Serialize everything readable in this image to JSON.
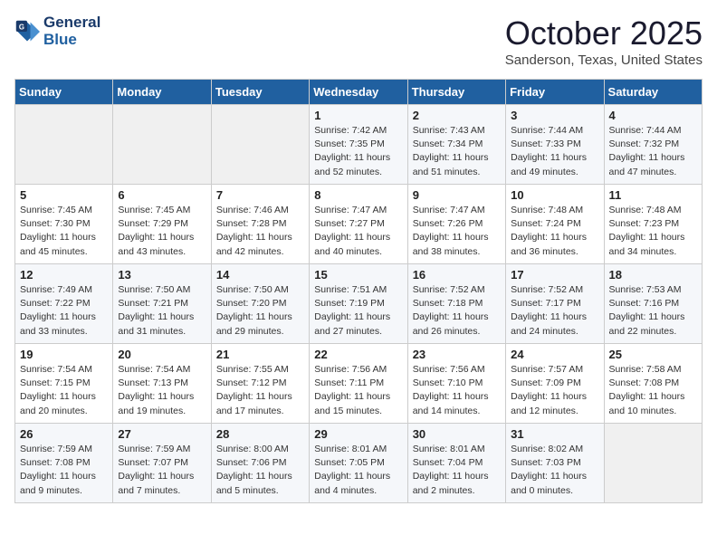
{
  "header": {
    "logo_general": "General",
    "logo_blue": "Blue",
    "month": "October 2025",
    "location": "Sanderson, Texas, United States"
  },
  "days_of_week": [
    "Sunday",
    "Monday",
    "Tuesday",
    "Wednesday",
    "Thursday",
    "Friday",
    "Saturday"
  ],
  "weeks": [
    [
      {
        "day": "",
        "content": ""
      },
      {
        "day": "",
        "content": ""
      },
      {
        "day": "",
        "content": ""
      },
      {
        "day": "1",
        "content": "Sunrise: 7:42 AM\nSunset: 7:35 PM\nDaylight: 11 hours\nand 52 minutes."
      },
      {
        "day": "2",
        "content": "Sunrise: 7:43 AM\nSunset: 7:34 PM\nDaylight: 11 hours\nand 51 minutes."
      },
      {
        "day": "3",
        "content": "Sunrise: 7:44 AM\nSunset: 7:33 PM\nDaylight: 11 hours\nand 49 minutes."
      },
      {
        "day": "4",
        "content": "Sunrise: 7:44 AM\nSunset: 7:32 PM\nDaylight: 11 hours\nand 47 minutes."
      }
    ],
    [
      {
        "day": "5",
        "content": "Sunrise: 7:45 AM\nSunset: 7:30 PM\nDaylight: 11 hours\nand 45 minutes."
      },
      {
        "day": "6",
        "content": "Sunrise: 7:45 AM\nSunset: 7:29 PM\nDaylight: 11 hours\nand 43 minutes."
      },
      {
        "day": "7",
        "content": "Sunrise: 7:46 AM\nSunset: 7:28 PM\nDaylight: 11 hours\nand 42 minutes."
      },
      {
        "day": "8",
        "content": "Sunrise: 7:47 AM\nSunset: 7:27 PM\nDaylight: 11 hours\nand 40 minutes."
      },
      {
        "day": "9",
        "content": "Sunrise: 7:47 AM\nSunset: 7:26 PM\nDaylight: 11 hours\nand 38 minutes."
      },
      {
        "day": "10",
        "content": "Sunrise: 7:48 AM\nSunset: 7:24 PM\nDaylight: 11 hours\nand 36 minutes."
      },
      {
        "day": "11",
        "content": "Sunrise: 7:48 AM\nSunset: 7:23 PM\nDaylight: 11 hours\nand 34 minutes."
      }
    ],
    [
      {
        "day": "12",
        "content": "Sunrise: 7:49 AM\nSunset: 7:22 PM\nDaylight: 11 hours\nand 33 minutes."
      },
      {
        "day": "13",
        "content": "Sunrise: 7:50 AM\nSunset: 7:21 PM\nDaylight: 11 hours\nand 31 minutes."
      },
      {
        "day": "14",
        "content": "Sunrise: 7:50 AM\nSunset: 7:20 PM\nDaylight: 11 hours\nand 29 minutes."
      },
      {
        "day": "15",
        "content": "Sunrise: 7:51 AM\nSunset: 7:19 PM\nDaylight: 11 hours\nand 27 minutes."
      },
      {
        "day": "16",
        "content": "Sunrise: 7:52 AM\nSunset: 7:18 PM\nDaylight: 11 hours\nand 26 minutes."
      },
      {
        "day": "17",
        "content": "Sunrise: 7:52 AM\nSunset: 7:17 PM\nDaylight: 11 hours\nand 24 minutes."
      },
      {
        "day": "18",
        "content": "Sunrise: 7:53 AM\nSunset: 7:16 PM\nDaylight: 11 hours\nand 22 minutes."
      }
    ],
    [
      {
        "day": "19",
        "content": "Sunrise: 7:54 AM\nSunset: 7:15 PM\nDaylight: 11 hours\nand 20 minutes."
      },
      {
        "day": "20",
        "content": "Sunrise: 7:54 AM\nSunset: 7:13 PM\nDaylight: 11 hours\nand 19 minutes."
      },
      {
        "day": "21",
        "content": "Sunrise: 7:55 AM\nSunset: 7:12 PM\nDaylight: 11 hours\nand 17 minutes."
      },
      {
        "day": "22",
        "content": "Sunrise: 7:56 AM\nSunset: 7:11 PM\nDaylight: 11 hours\nand 15 minutes."
      },
      {
        "day": "23",
        "content": "Sunrise: 7:56 AM\nSunset: 7:10 PM\nDaylight: 11 hours\nand 14 minutes."
      },
      {
        "day": "24",
        "content": "Sunrise: 7:57 AM\nSunset: 7:09 PM\nDaylight: 11 hours\nand 12 minutes."
      },
      {
        "day": "25",
        "content": "Sunrise: 7:58 AM\nSunset: 7:08 PM\nDaylight: 11 hours\nand 10 minutes."
      }
    ],
    [
      {
        "day": "26",
        "content": "Sunrise: 7:59 AM\nSunset: 7:08 PM\nDaylight: 11 hours\nand 9 minutes."
      },
      {
        "day": "27",
        "content": "Sunrise: 7:59 AM\nSunset: 7:07 PM\nDaylight: 11 hours\nand 7 minutes."
      },
      {
        "day": "28",
        "content": "Sunrise: 8:00 AM\nSunset: 7:06 PM\nDaylight: 11 hours\nand 5 minutes."
      },
      {
        "day": "29",
        "content": "Sunrise: 8:01 AM\nSunset: 7:05 PM\nDaylight: 11 hours\nand 4 minutes."
      },
      {
        "day": "30",
        "content": "Sunrise: 8:01 AM\nSunset: 7:04 PM\nDaylight: 11 hours\nand 2 minutes."
      },
      {
        "day": "31",
        "content": "Sunrise: 8:02 AM\nSunset: 7:03 PM\nDaylight: 11 hours\nand 0 minutes."
      },
      {
        "day": "",
        "content": ""
      }
    ]
  ]
}
